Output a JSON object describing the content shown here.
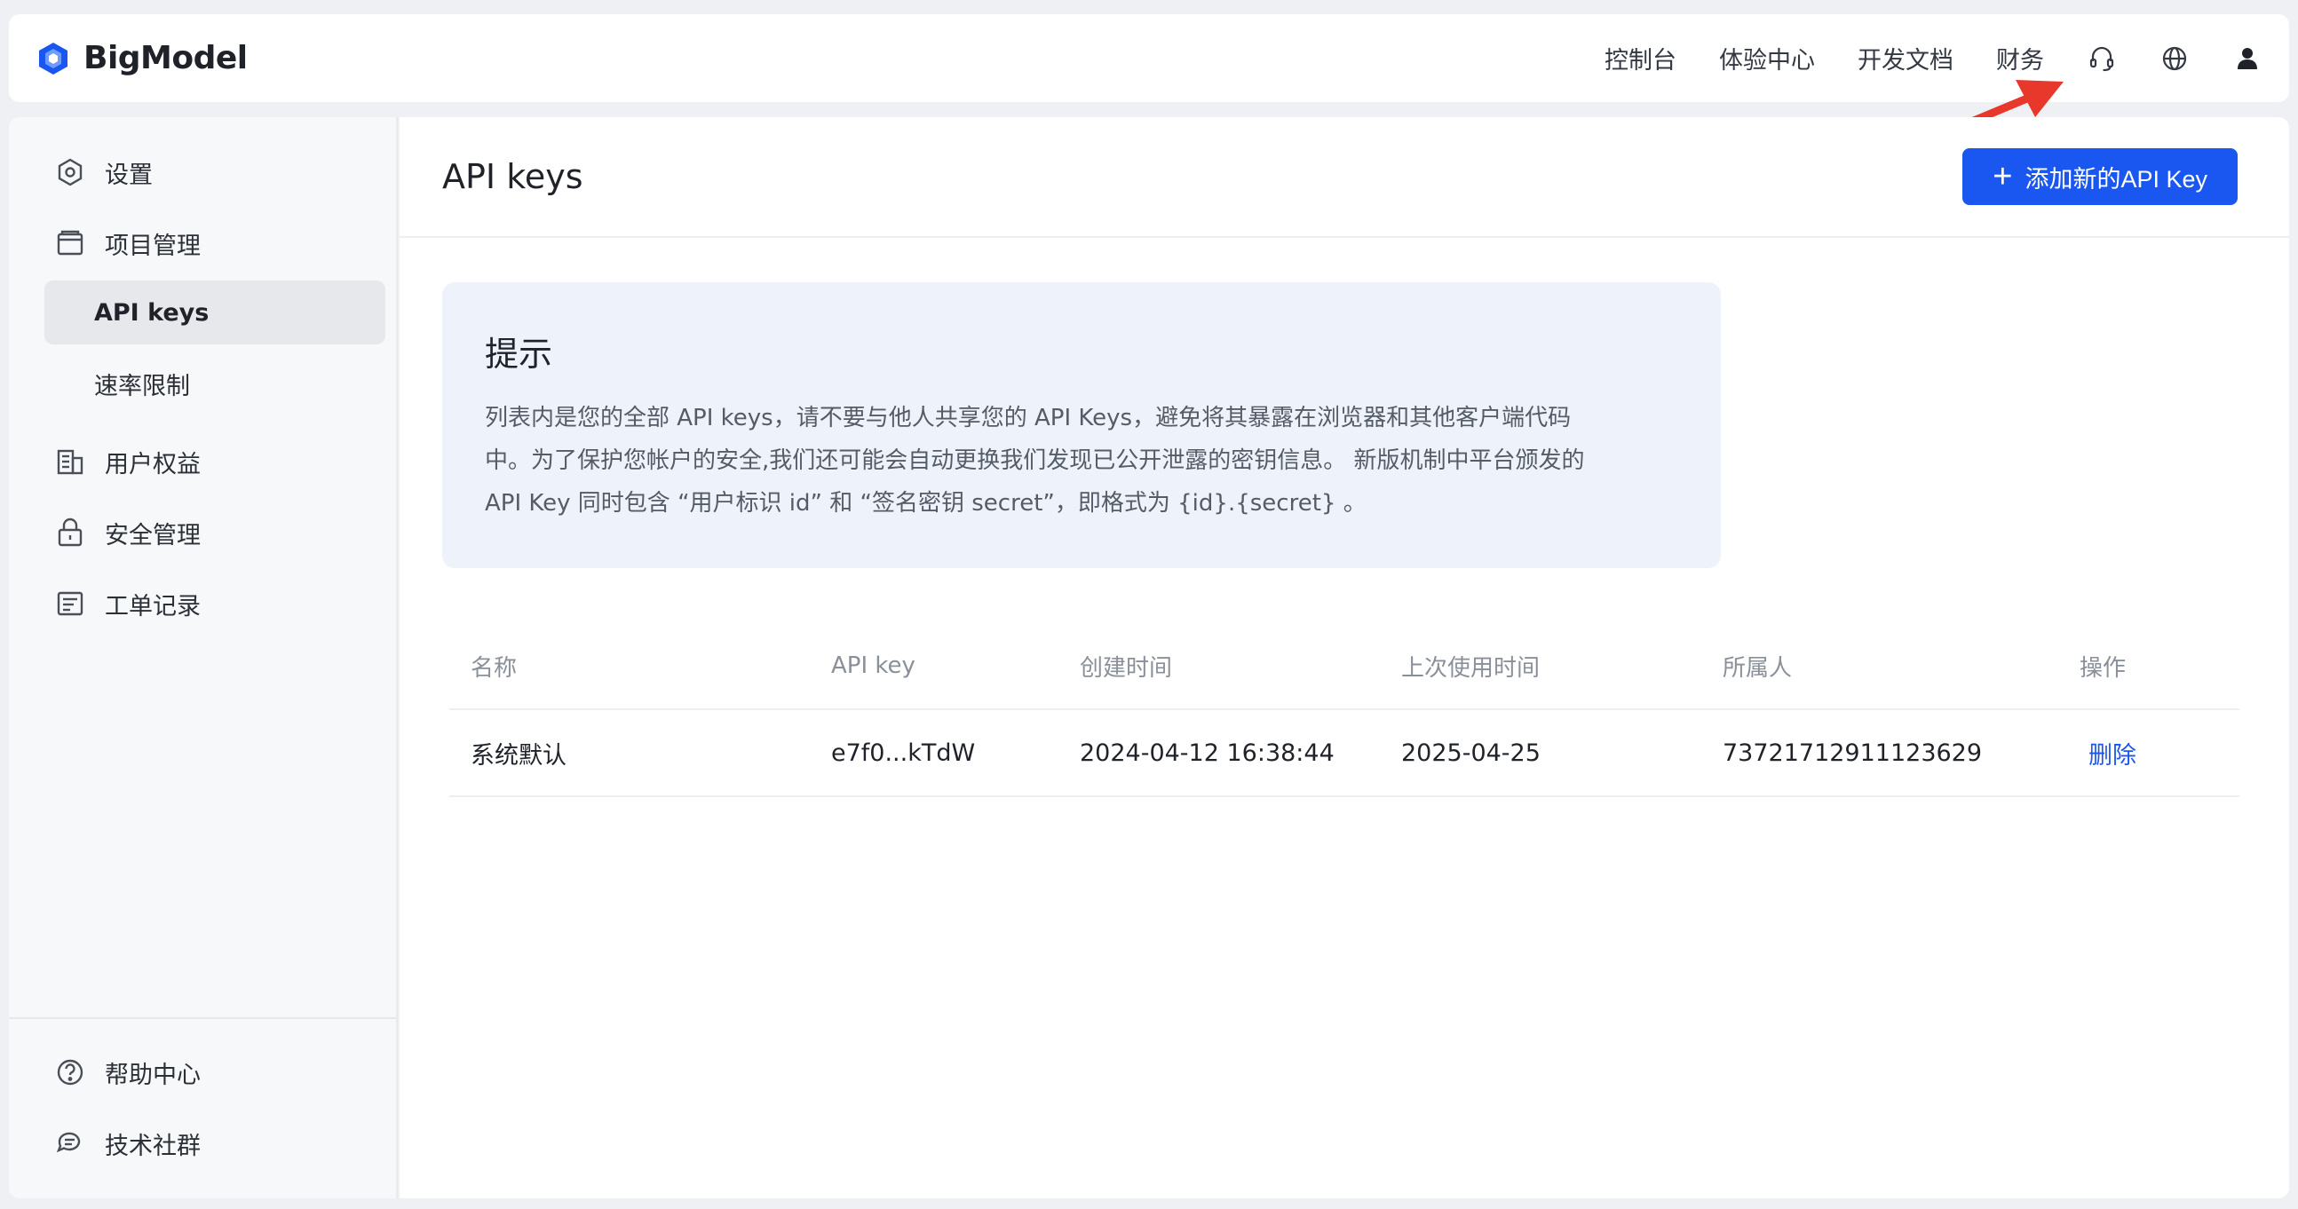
{
  "brand": {
    "name": "BigModel",
    "logo_icon": "bigmodel-logo-icon",
    "logo_color": "#1a56f0"
  },
  "topnav": {
    "items": [
      "控制台",
      "体验中心",
      "开发文档",
      "财务"
    ],
    "icons": [
      "headset-icon",
      "globe-icon",
      "user-icon"
    ]
  },
  "sidebar": {
    "items": [
      {
        "label": "设置",
        "icon": "settings-icon"
      },
      {
        "label": "项目管理",
        "icon": "project-icon"
      },
      {
        "label": "API keys",
        "sub": true,
        "active": true
      },
      {
        "label": "速率限制",
        "sub": true
      },
      {
        "label": "用户权益",
        "icon": "building-icon"
      },
      {
        "label": "安全管理",
        "icon": "lock-icon"
      },
      {
        "label": "工单记录",
        "icon": "ticket-icon"
      }
    ],
    "bottom": [
      {
        "label": "帮助中心",
        "icon": "help-icon"
      },
      {
        "label": "技术社群",
        "icon": "chat-icon"
      }
    ]
  },
  "main": {
    "title": "API keys",
    "add_button": "添加新的API Key",
    "tip": {
      "title": "提示",
      "lines": [
        "列表内是您的全部 API keys，请不要与他人共享您的 API Keys，避免将其暴露在浏览器和其他客户端代码",
        "中。为了保护您帐户的安全,我们还可能会自动更换我们发现已公开泄露的密钥信息。 新版机制中平台颁发的",
        "API Key 同时包含 “用户标识 id” 和 “签名密钥 secret”，即格式为 {id}.{secret} 。"
      ]
    },
    "table": {
      "columns": [
        "名称",
        "API key",
        "创建时间",
        "上次使用时间",
        "所属人",
        "操作"
      ],
      "rows": [
        {
          "name": "系统默认",
          "key": "e7f0...kTdW",
          "created": "2024-04-12 16:38:44",
          "last_used": "2025-04-25",
          "owner": "73721712911123629",
          "action": "删除"
        }
      ]
    }
  },
  "colors": {
    "accent": "#1a56f0",
    "annotation_arrow": "#e8382b"
  }
}
